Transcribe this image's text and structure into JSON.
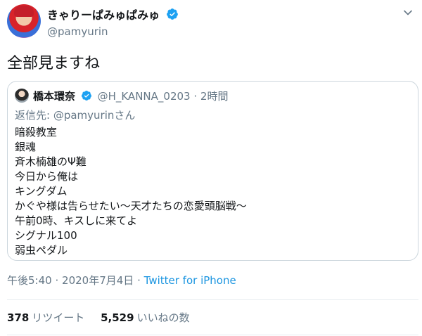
{
  "author": {
    "display_name": "きゃりーぱみゅぱみゅ",
    "handle": "@pamyurin",
    "verified_icon": "verified-badge-icon",
    "avatar_icon": "profile-avatar"
  },
  "menu_icon": "chevron-down-icon",
  "tweet": {
    "text": "全部見ますね"
  },
  "quoted_tweet": {
    "display_name": "橋本環奈",
    "handle": "@H_KANNA_0203",
    "separator": "·",
    "time": "2時間",
    "reply_to": "返信先: @pamyurinさん",
    "lines": [
      "暗殺教室",
      "銀魂",
      "斉木楠雄のΨ難",
      "今日から俺は",
      "キングダム",
      "かぐや様は告らせたい〜天才たちの恋愛頭脳戦〜",
      "午前0時、キスしに来てよ",
      "シグナル100",
      "弱虫ペダル"
    ]
  },
  "meta": {
    "time": "午後5:40",
    "separator1": "·",
    "date": "2020年7月4日",
    "separator2": "·",
    "source": "Twitter for iPhone"
  },
  "stats": {
    "retweets_count": "378",
    "retweets_label": "リツイート",
    "likes_count": "5,529",
    "likes_label": "いいねの数"
  },
  "colors": {
    "verified_blue": "#1da1f2",
    "link_blue": "#1b95e0",
    "secondary_text": "#657786",
    "border": "#ccd6dd"
  }
}
